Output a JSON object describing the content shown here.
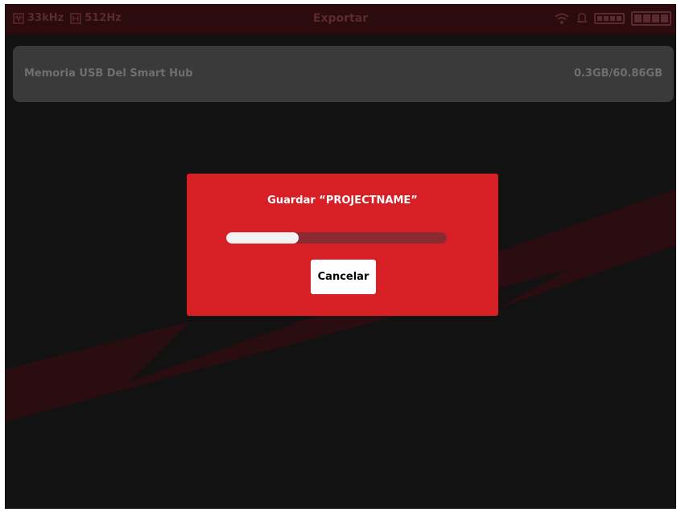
{
  "status_bar": {
    "sample_rate": "33kHz",
    "buffer": "512Hz",
    "title": "Exportar"
  },
  "storage": {
    "name": "Memoria USB Del Smart Hub",
    "capacity": "0.3GB/60.86GB"
  },
  "dialog": {
    "title": "Guardar “PROJECTNAME”",
    "progress_percent": 33,
    "cancel_label": "Cancelar"
  },
  "colors": {
    "dialog_bg": "#d71f26",
    "screen_bg": "#121212",
    "accent_dim": "#5a2a2f"
  },
  "icons": {
    "sample_rate": "waveform-icon",
    "buffer": "buffer-icon",
    "wifi": "wifi-icon",
    "notification": "bell-icon",
    "battery_small": "battery-icon",
    "battery_large": "battery-full-icon"
  }
}
